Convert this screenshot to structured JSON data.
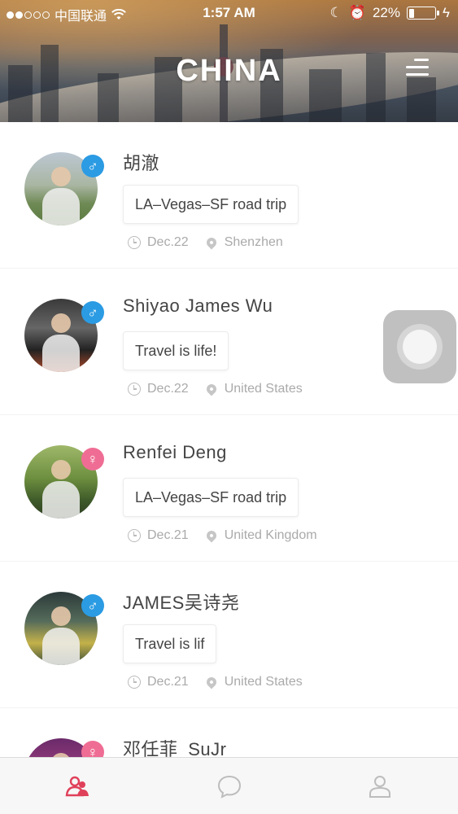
{
  "status_bar": {
    "carrier": "中国联通",
    "time": "1:57 AM",
    "battery": "22%",
    "battery_level": 0.22
  },
  "header": {
    "title": "CHINA",
    "menu_icon": "hamburger-menu-icon"
  },
  "trips": [
    {
      "name": "胡澈",
      "gender": "male",
      "gender_symbol": "♂",
      "message": "LA–Vegas–SF road trip",
      "date": "Dec.22",
      "location": "Shenzhen"
    },
    {
      "name": "Shiyao James Wu",
      "gender": "male",
      "gender_symbol": "♂",
      "message": "Travel is life!",
      "date": "Dec.22",
      "location": "United States"
    },
    {
      "name": "Renfei Deng",
      "gender": "female",
      "gender_symbol": "♀",
      "message": "LA–Vegas–SF road trip",
      "date": "Dec.21",
      "location": "United Kingdom"
    },
    {
      "name": "JAMES吴诗尧",
      "gender": "male",
      "gender_symbol": "♂",
      "message": "Travel is lif",
      "date": "Dec.21",
      "location": "United States"
    },
    {
      "name": "邓任菲_SuJr",
      "gender": "female",
      "gender_symbol": "♀",
      "message": "",
      "date": "",
      "location": ""
    }
  ],
  "tab_bar": {
    "tabs": [
      {
        "icon": "people-icon",
        "active": true
      },
      {
        "icon": "chat-bubble-icon",
        "active": false
      },
      {
        "icon": "profile-icon",
        "active": false
      }
    ]
  },
  "colors": {
    "male": "#2b9be3",
    "female": "#ef6d94",
    "tab_active": "#e0415a",
    "tab_inactive": "#bdbdbd"
  }
}
